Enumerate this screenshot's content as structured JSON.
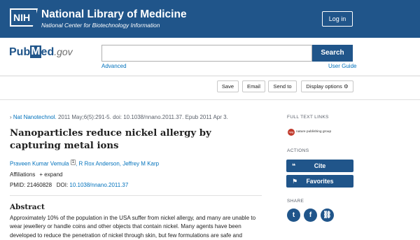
{
  "header": {
    "nih_badge": "NIH",
    "title": "National Library of Medicine",
    "subtitle": "National Center for Biotechnology Information",
    "login": "Log in"
  },
  "search": {
    "logo_pub": "Pub",
    "logo_m": "M",
    "logo_ed": "ed",
    "logo_gov": ".gov",
    "placeholder": "",
    "button": "Search",
    "advanced": "Advanced",
    "user_guide": "User Guide"
  },
  "actions": {
    "save": "Save",
    "email": "Email",
    "send_to": "Send to",
    "display_options": "Display options",
    "display_icon": "gear-icon"
  },
  "article": {
    "journal": "Nat Nanotechnol.",
    "citation": " 2011 May;6(5):291-5. doi: 10.1038/nnano.2011.37. Epub 2011 Apr 3.",
    "title": "Nanoparticles reduce nickel allergy by capturing metal ions",
    "author1": "Praveen Kumar Vemula",
    "author1_sup": "1",
    "author_rest": ", R Rox Anderson, Jeffrey M Karp",
    "affiliations": "Affiliations",
    "expand": "+ expand",
    "pmid_label": "PMID: 21460828",
    "doi_label": "DOI: ",
    "doi_value": "10.1038/nnano.2011.37",
    "abstract_heading": "Abstract",
    "abstract_text": "Approximately 10% of the population in the USA suffer from nickel allergy, and many are unable to wear jewellery or handle coins and other objects that contain nickel. Many agents have been developed to reduce the penetration of nickel through skin, but few formulations are safe and"
  },
  "sidebar": {
    "full_text_links": "FULL TEXT LINKS",
    "publisher_logo_text": "npg",
    "publisher": "nature publishing group",
    "actions_label": "ACTIONS",
    "cite": "Cite",
    "cite_icon": "quote-icon",
    "favorites": "Favorites",
    "favorites_icon": "bookmark-icon",
    "share_label": "SHARE",
    "twitter": "t",
    "facebook": "f",
    "link": "⛓"
  },
  "colors": {
    "brand": "#20558a",
    "link": "#0071bc"
  }
}
